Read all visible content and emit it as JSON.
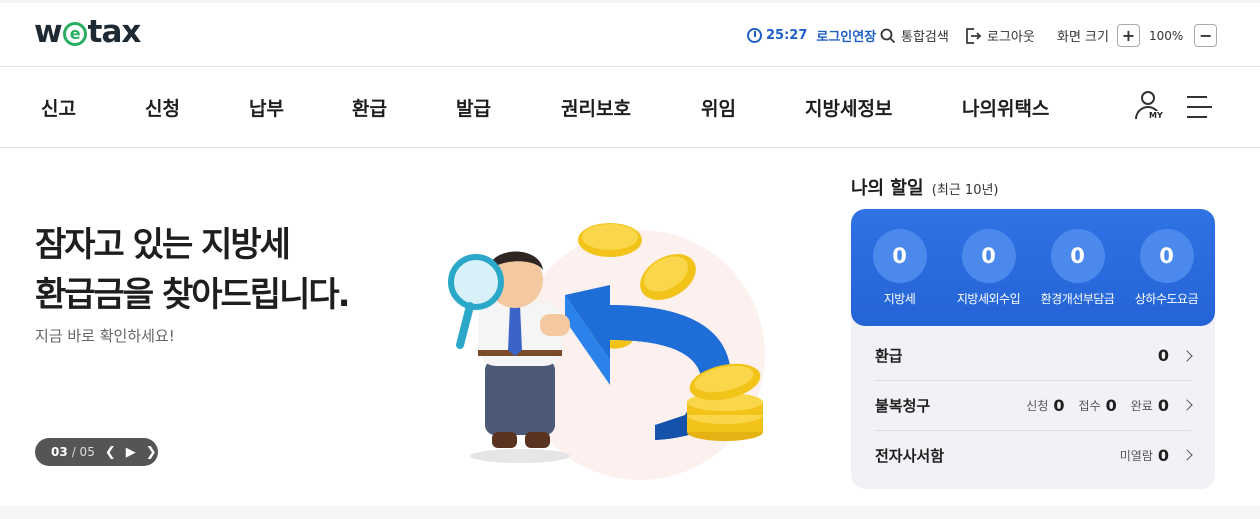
{
  "header": {
    "logo_prefix": "w",
    "logo_e": "e",
    "logo_suffix": "tax",
    "timer": "25:27",
    "extend_label": "로그인연장",
    "search_label": "통합검색",
    "logout_label": "로그아웃",
    "zoom_label": "화면 크기",
    "zoom_in": "+",
    "zoom_value": "100%",
    "zoom_out": "−"
  },
  "nav": {
    "items": [
      "신고",
      "신청",
      "납부",
      "환급",
      "발급",
      "권리보호",
      "위임",
      "지방세정보",
      "나의위택스"
    ],
    "my_label": "MY"
  },
  "banner": {
    "title_line1": "잠자고 있는 지방세",
    "title_line2": "환급금을 찾아드립니다.",
    "subtitle": "지금 바로 확인하세요!",
    "current_slide": "03",
    "total_slides": "/ 05"
  },
  "todo": {
    "title": "나의 할일",
    "period": "(최근 10년)",
    "summary": [
      {
        "value": "0",
        "label": "지방세"
      },
      {
        "value": "0",
        "label": "지방세외수입"
      },
      {
        "value": "0",
        "label": "환경개선부담금"
      },
      {
        "value": "0",
        "label": "상하수도요금"
      }
    ],
    "refund": {
      "label": "환급",
      "value": "0"
    },
    "objection": {
      "label": "불복청구",
      "apply_label": "신청",
      "apply_value": "0",
      "receipt_label": "접수",
      "receipt_value": "0",
      "done_label": "완료",
      "done_value": "0"
    },
    "mailbox": {
      "label": "전자사서함",
      "unread_label": "미열람",
      "unread_value": "0"
    }
  },
  "colors": {
    "accent_blue": "#2464d6",
    "logo_green": "#27ae60",
    "timer_blue": "#1f5fc8"
  }
}
